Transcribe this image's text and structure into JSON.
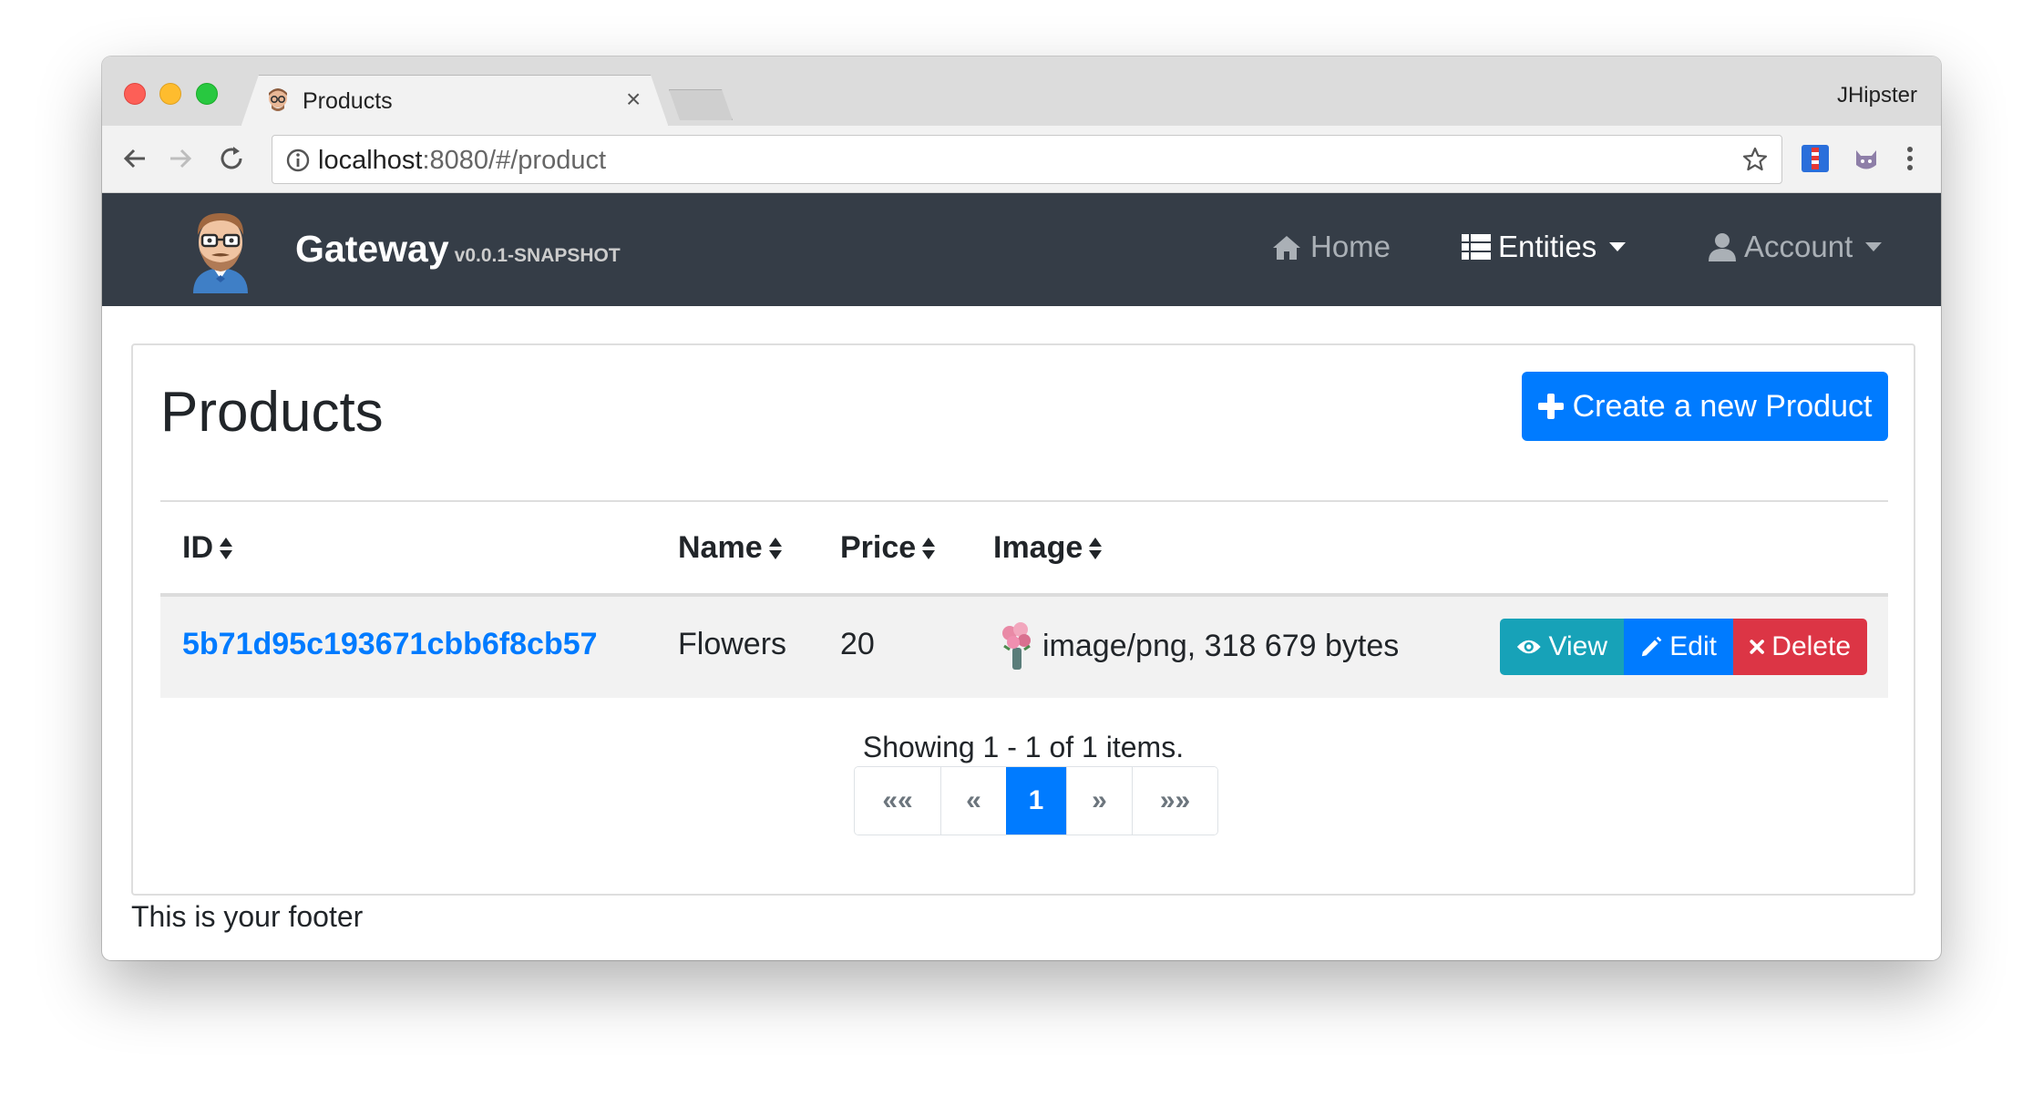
{
  "browser": {
    "tab_title": "Products",
    "tab_close": "×",
    "profile_name": "JHipster",
    "url_host": "localhost",
    "url_rest": ":8080/#/product"
  },
  "navbar": {
    "brand": "Gateway",
    "version": "v0.0.1-SNAPSHOT",
    "home": "Home",
    "entities": "Entities",
    "account": "Account"
  },
  "page": {
    "title": "Products",
    "create_label": "Create a new Product"
  },
  "table": {
    "columns": [
      "ID",
      "Name",
      "Price",
      "Image"
    ],
    "rows": [
      {
        "id": "5b71d95c193671cbb6f8cb57",
        "name": "Flowers",
        "price": "20",
        "image": "image/png, 318 679 bytes"
      }
    ],
    "actions": {
      "view": "View",
      "edit": "Edit",
      "delete": "Delete"
    }
  },
  "pagination": {
    "summary": "Showing 1 - 1 of 1 items.",
    "first": "««",
    "prev": "«",
    "current": "1",
    "next": "»",
    "last": "»»"
  },
  "footer": {
    "text": "This is your footer"
  },
  "colors": {
    "navbar": "#353d47",
    "primary": "#007bff",
    "info": "#17a2b8",
    "danger": "#dc3545"
  }
}
